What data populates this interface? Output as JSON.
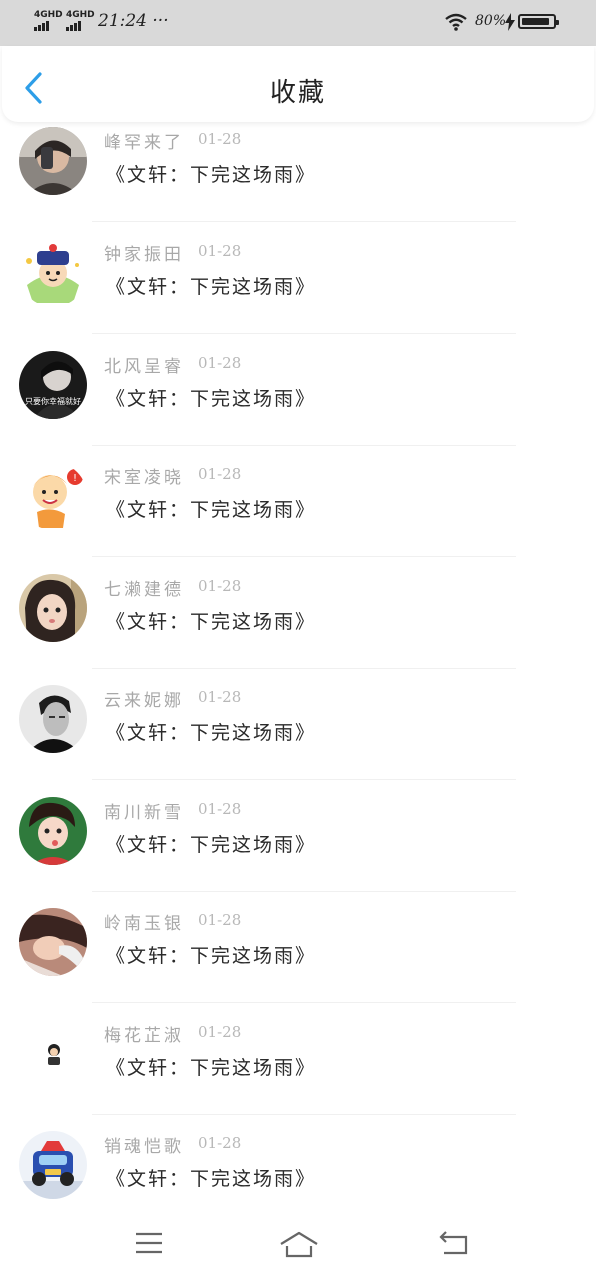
{
  "status_bar": {
    "network_1": "4GHD",
    "network_2": "4GHD",
    "time": "21:24 ···",
    "battery": "80%",
    "icons": [
      "signal-icon",
      "wifi-icon",
      "charging-icon",
      "battery-icon"
    ]
  },
  "header": {
    "title": "收藏",
    "back_icon": "chevron-left-icon",
    "accent": "#2d9ee8"
  },
  "favorites": [
    {
      "name": "峰罕来了",
      "date": "01-28",
      "content": "《文轩：下完这场雨》"
    },
    {
      "name": "钟家振田",
      "date": "01-28",
      "content": "《文轩：下完这场雨》"
    },
    {
      "name": "北风呈睿",
      "date": "01-28",
      "content": "《文轩：下完这场雨》",
      "avatar_caption": "只要你幸福就好"
    },
    {
      "name": "宋室凌晓",
      "date": "01-28",
      "content": "《文轩：下完这场雨》"
    },
    {
      "name": "七濑建德",
      "date": "01-28",
      "content": "《文轩：下完这场雨》"
    },
    {
      "name": "云来妮娜",
      "date": "01-28",
      "content": "《文轩：下完这场雨》"
    },
    {
      "name": "南川新雪",
      "date": "01-28",
      "content": "《文轩：下完这场雨》"
    },
    {
      "name": "岭南玉银",
      "date": "01-28",
      "content": "《文轩：下完这场雨》"
    },
    {
      "name": "梅花芷淑",
      "date": "01-28",
      "content": "《文轩：下完这场雨》"
    },
    {
      "name": "销魂恺歌",
      "date": "01-28",
      "content": "《文轩：下完这场雨》"
    }
  ],
  "bottom_nav": {
    "icons": [
      "menu-icon",
      "home-icon",
      "back-icon"
    ]
  }
}
